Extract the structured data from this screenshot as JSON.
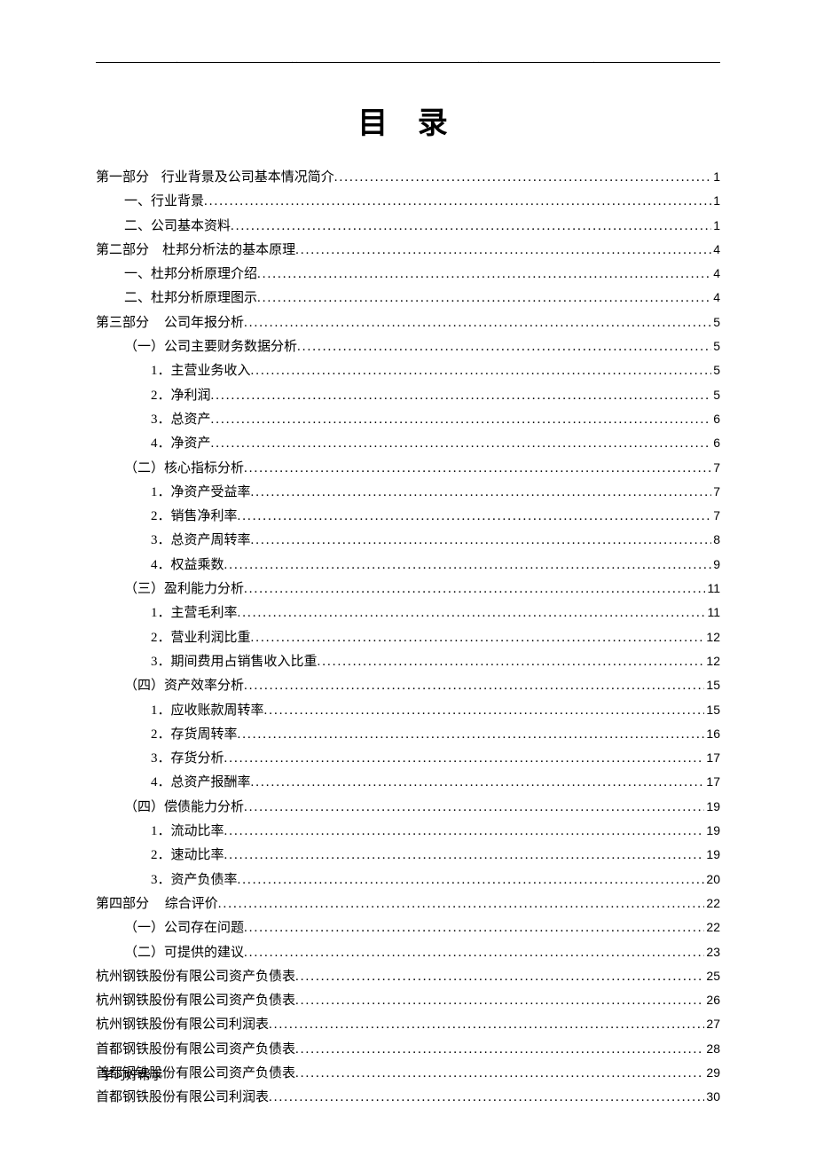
{
  "title": "目 录",
  "footer": "学习好帮手",
  "toc": [
    {
      "level": 0,
      "label": "第一部分",
      "suffix": "行业背景及公司基本情况简介",
      "page": "1",
      "gap": true
    },
    {
      "level": 1,
      "label": "一、行业背景",
      "page": "1"
    },
    {
      "level": 1,
      "label": "二、公司基本资料",
      "page": "1"
    },
    {
      "level": 0,
      "label": "第二部分",
      "suffix": "杜邦分析法的基本原理",
      "page": "4",
      "gap": true
    },
    {
      "level": 1,
      "label": "一、杜邦分析原理介绍",
      "page": "4"
    },
    {
      "level": 1,
      "label": "二、杜邦分析原理图示",
      "page": "4"
    },
    {
      "level": 0,
      "label": "第三部分",
      "suffix": "公司年报分析",
      "page": "5",
      "gap": true
    },
    {
      "level": 2,
      "label": "（一）公司主要财务数据分析",
      "page": "5"
    },
    {
      "level": 3,
      "label": "1．主营业务收入",
      "page": "5"
    },
    {
      "level": 3,
      "label": "2．净利润",
      "page": "5"
    },
    {
      "level": 3,
      "label": "3．总资产",
      "page": "6"
    },
    {
      "level": 3,
      "label": "4．净资产",
      "page": "6"
    },
    {
      "level": 2,
      "label": "（二）核心指标分析",
      "page": "7"
    },
    {
      "level": 3,
      "label": "1．净资产受益率",
      "page": "7"
    },
    {
      "level": 3,
      "label": "2．销售净利率",
      "page": "7"
    },
    {
      "level": 3,
      "label": "3．总资产周转率",
      "page": "8"
    },
    {
      "level": 3,
      "label": "4．权益乘数",
      "page": "9"
    },
    {
      "level": 2,
      "label": "（三）盈利能力分析",
      "page": "11"
    },
    {
      "level": 3,
      "label": "1．主营毛利率",
      "page": "11"
    },
    {
      "level": 3,
      "label": "2．营业利润比重",
      "page": "12"
    },
    {
      "level": 3,
      "label": "3．期间费用占销售收入比重",
      "page": "12"
    },
    {
      "level": 2,
      "label": "（四）资产效率分析",
      "page": "15"
    },
    {
      "level": 3,
      "label": "1．应收账款周转率",
      "page": "15"
    },
    {
      "level": 3,
      "label": "2．存货周转率",
      "page": "16"
    },
    {
      "level": 3,
      "label": "3．存货分析",
      "page": "17"
    },
    {
      "level": 3,
      "label": "4．总资产报酬率",
      "page": "17"
    },
    {
      "level": 2,
      "label": "（四）偿债能力分析",
      "page": "19"
    },
    {
      "level": 3,
      "label": "1．流动比率",
      "page": "19"
    },
    {
      "level": 3,
      "label": "2．速动比率",
      "page": "19"
    },
    {
      "level": 3,
      "label": "3．资产负债率",
      "page": "20"
    },
    {
      "level": 0,
      "label": "第四部分",
      "suffix": "综合评价",
      "page": "22",
      "gap": true
    },
    {
      "level": 2,
      "label": "（一）公司存在问题",
      "page": "22"
    },
    {
      "level": 2,
      "label": "（二）可提供的建议",
      "page": "23"
    },
    {
      "level": 0,
      "label": "杭州钢铁股份有限公司资产负债表",
      "page": "25"
    },
    {
      "level": 0,
      "label": "杭州钢铁股份有限公司资产负债表",
      "page": "26"
    },
    {
      "level": 0,
      "label": "杭州钢铁股份有限公司利润表",
      "page": "27"
    },
    {
      "level": 0,
      "label": "首都钢铁股份有限公司资产负债表",
      "page": "28"
    },
    {
      "level": 0,
      "label": "首都钢铁股份有限公司资产负债表",
      "page": "29"
    },
    {
      "level": 0,
      "label": "首都钢铁股份有限公司利润表",
      "page": "30"
    }
  ]
}
